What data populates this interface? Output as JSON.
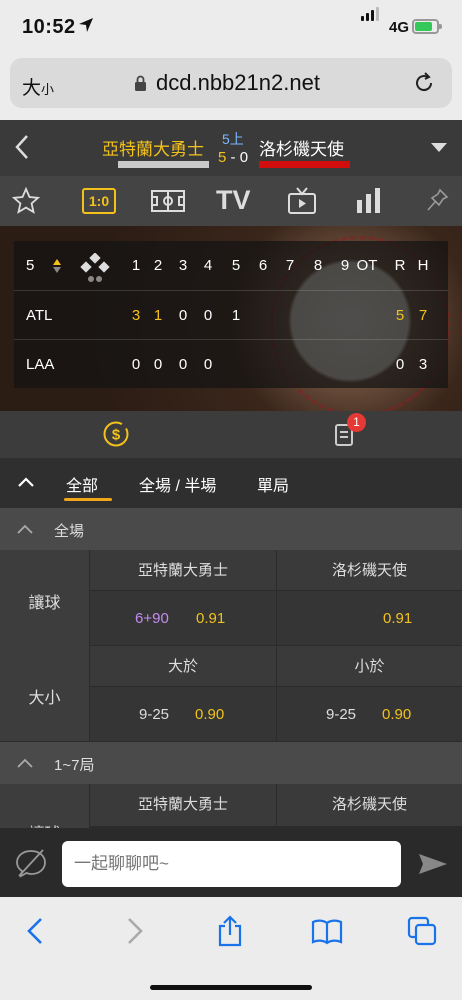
{
  "status_bar": {
    "time": "10:52",
    "network": "4G"
  },
  "browser": {
    "text_size_label": "大",
    "text_size_small": "小",
    "url": "dcd.nbb21n2.net"
  },
  "match": {
    "home_team": "亞特蘭大勇士",
    "away_team": "洛杉磯天使",
    "inning": "5上",
    "score_home": "5",
    "score_sep": " - ",
    "score_away": "0"
  },
  "toolbar": {
    "score_icon_label": "1:0",
    "tv_label": "TV"
  },
  "scoreboard": {
    "current_inning": "5",
    "columns": [
      "1",
      "2",
      "3",
      "4",
      "5",
      "6",
      "7",
      "8",
      "9",
      "OT",
      "R",
      "H"
    ],
    "rows": [
      {
        "team": "ATL",
        "innings": [
          "3",
          "1",
          "0",
          "0",
          "1",
          "",
          "",
          "",
          "",
          ""
        ],
        "r": "5",
        "h": "7"
      },
      {
        "team": "LAA",
        "innings": [
          "0",
          "0",
          "0",
          "0",
          "",
          "",
          "",
          "",
          "",
          ""
        ],
        "r": "0",
        "h": "3"
      }
    ]
  },
  "notifications": {
    "badge_count": "1"
  },
  "filter_tabs": [
    "全部",
    "全場 / 半場",
    "單局"
  ],
  "sections": [
    {
      "title": "全場",
      "markets": [
        {
          "name": "讓球",
          "headers": [
            "亞特蘭大勇士",
            "洛杉磯天使"
          ],
          "odds": [
            {
              "line": "6+90",
              "odd": "0.91"
            },
            {
              "line": "",
              "odd": "0.91"
            }
          ]
        },
        {
          "name": "大小",
          "headers": [
            "大於",
            "小於"
          ],
          "odds": [
            {
              "line": "9-25",
              "odd": "0.90"
            },
            {
              "line": "9-25",
              "odd": "0.90"
            }
          ]
        }
      ]
    },
    {
      "title": "1~7局",
      "markets": [
        {
          "name": "讓球",
          "headers": [
            "亞特蘭大勇士",
            "洛杉磯天使"
          ]
        }
      ]
    }
  ],
  "chat": {
    "placeholder": "一起聊聊吧~"
  },
  "colors": {
    "accent": "#f2c21b",
    "home_bar": "#c9c9c9",
    "away_bar": "#d20d0d",
    "line_purple": "#c48cf0",
    "badge": "#e53935"
  }
}
